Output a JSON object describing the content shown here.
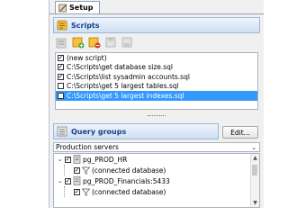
{
  "tab": {
    "label": "Setup"
  },
  "scripts": {
    "title": "Scripts",
    "items": [
      {
        "label": "(new script)",
        "checked": true,
        "selected": false
      },
      {
        "label": "C:\\Scripts\\get database size.sql",
        "checked": true,
        "selected": false
      },
      {
        "label": "C:\\Scripts\\list sysadmin accounts.sql",
        "checked": true,
        "selected": false
      },
      {
        "label": "C:\\Scripts\\get 5 largest tables.sql",
        "checked": false,
        "selected": false
      },
      {
        "label": "C:\\Scripts\\get 5 largest indexes.sql",
        "checked": false,
        "selected": true
      }
    ]
  },
  "query_groups": {
    "title": "Query groups",
    "edit_label": "Edit...",
    "selected_group": "Production servers",
    "servers": [
      {
        "name": "pg_PROD_HR",
        "child": "(connected database)"
      },
      {
        "name": "pg_PROD_Financials:5433",
        "child": "(connected database)"
      }
    ]
  },
  "colors": {
    "selection": "#3399ff",
    "header_text": "#15428b"
  }
}
